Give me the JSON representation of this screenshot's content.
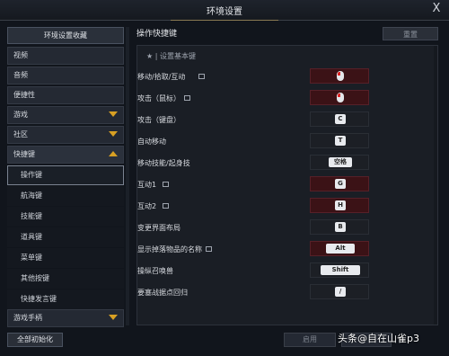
{
  "window": {
    "title": "环境设置",
    "close": "X"
  },
  "sidebar": {
    "header": "环境设置收藏",
    "items": [
      {
        "label": "视频"
      },
      {
        "label": "音频"
      },
      {
        "label": "便捷性"
      },
      {
        "label": "游戏"
      },
      {
        "label": "社区"
      },
      {
        "label": "快捷键"
      }
    ],
    "subitems": [
      {
        "label": "操作键"
      },
      {
        "label": "航海键"
      },
      {
        "label": "技能键"
      },
      {
        "label": "道具键"
      },
      {
        "label": "菜单键"
      },
      {
        "label": "其他按键"
      },
      {
        "label": "快捷发言键"
      }
    ],
    "last": {
      "label": "游戏手柄"
    }
  },
  "main": {
    "title": "操作快捷键",
    "reset_label": "重置",
    "section": "设置基本键",
    "rows": [
      {
        "label": "移动/拾取/互动",
        "locked": true,
        "key": "",
        "red": true,
        "mouse": true
      },
      {
        "label": "攻击（鼠标）",
        "locked": true,
        "key": "",
        "red": true,
        "mouse": true
      },
      {
        "label": "攻击（键盘）",
        "locked": false,
        "key": "C"
      },
      {
        "label": "自动移动",
        "locked": false,
        "key": "T"
      },
      {
        "label": "移动技能/起身技",
        "locked": false,
        "key": "空格"
      },
      {
        "label": "互动1",
        "locked": true,
        "key": "G",
        "red": true
      },
      {
        "label": "互动2",
        "locked": true,
        "key": "H",
        "red": true
      },
      {
        "label": "变更界面布局",
        "locked": false,
        "key": "B"
      },
      {
        "label": "显示掉落物品的名称",
        "locked": true,
        "key": "Alt",
        "red": true
      },
      {
        "label": "操纵召唤兽",
        "locked": false,
        "key": "Shift"
      },
      {
        "label": "要塞战据点回归",
        "locked": false,
        "key": "/"
      }
    ]
  },
  "footer": {
    "reset_all": "全部初始化",
    "apply": "启用",
    "watermark": "头条@自在山雀p3"
  }
}
